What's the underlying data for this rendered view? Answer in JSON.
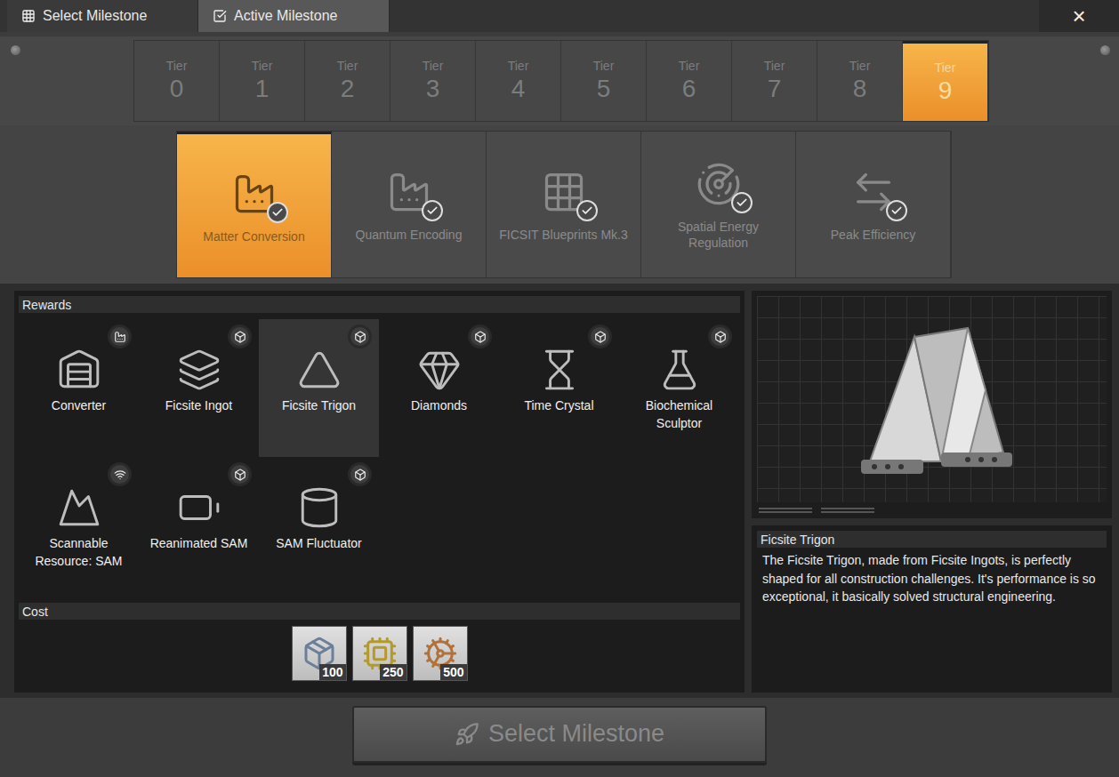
{
  "tabs": [
    {
      "label": "Select Milestone",
      "selected": true
    },
    {
      "label": "Active Milestone",
      "selected": false
    }
  ],
  "close": "×",
  "tiers": [
    {
      "label": "Tier",
      "number": "0",
      "selected": false
    },
    {
      "label": "Tier",
      "number": "1",
      "selected": false
    },
    {
      "label": "Tier",
      "number": "2",
      "selected": false
    },
    {
      "label": "Tier",
      "number": "3",
      "selected": false
    },
    {
      "label": "Tier",
      "number": "4",
      "selected": false
    },
    {
      "label": "Tier",
      "number": "5",
      "selected": false
    },
    {
      "label": "Tier",
      "number": "6",
      "selected": false
    },
    {
      "label": "Tier",
      "number": "7",
      "selected": false
    },
    {
      "label": "Tier",
      "number": "8",
      "selected": false
    },
    {
      "label": "Tier",
      "number": "9",
      "selected": true
    }
  ],
  "milestones": [
    {
      "label": "Matter Conversion",
      "selected": true,
      "completed": true
    },
    {
      "label": "Quantum Encoding",
      "selected": false,
      "completed": true
    },
    {
      "label": "FICSIT Blueprints Mk.3",
      "selected": false,
      "completed": true
    },
    {
      "label": "Spatial Energy Regulation",
      "selected": false,
      "completed": true
    },
    {
      "label": "Peak Efficiency",
      "selected": false,
      "completed": true
    }
  ],
  "rewards": {
    "title": "Rewards",
    "items": [
      {
        "label": "Converter",
        "kind": "building",
        "selected": false
      },
      {
        "label": "Ficsite Ingot",
        "kind": "item",
        "selected": false
      },
      {
        "label": "Ficsite Trigon",
        "kind": "item",
        "selected": true
      },
      {
        "label": "Diamonds",
        "kind": "item",
        "selected": false
      },
      {
        "label": "Time Crystal",
        "kind": "item",
        "selected": false
      },
      {
        "label": "Biochemical Sculptor",
        "kind": "item",
        "selected": false
      },
      {
        "label": "Scannable Resource: SAM",
        "kind": "scannable",
        "selected": false
      },
      {
        "label": "Reanimated SAM",
        "kind": "item",
        "selected": false
      },
      {
        "label": "SAM Fluctuator",
        "kind": "item",
        "selected": false
      }
    ]
  },
  "cost": {
    "title": "Cost",
    "items": [
      {
        "count": "100"
      },
      {
        "count": "250"
      },
      {
        "count": "500"
      }
    ]
  },
  "detail": {
    "title": "Ficsite Trigon",
    "description": "The Ficsite Trigon, made from Ficsite Ingots, is perfectly shaped for all construction challenges. It's performance is so exceptional, it basically solved structural engineering."
  },
  "button": {
    "label": "Select Milestone",
    "disabled": true
  }
}
